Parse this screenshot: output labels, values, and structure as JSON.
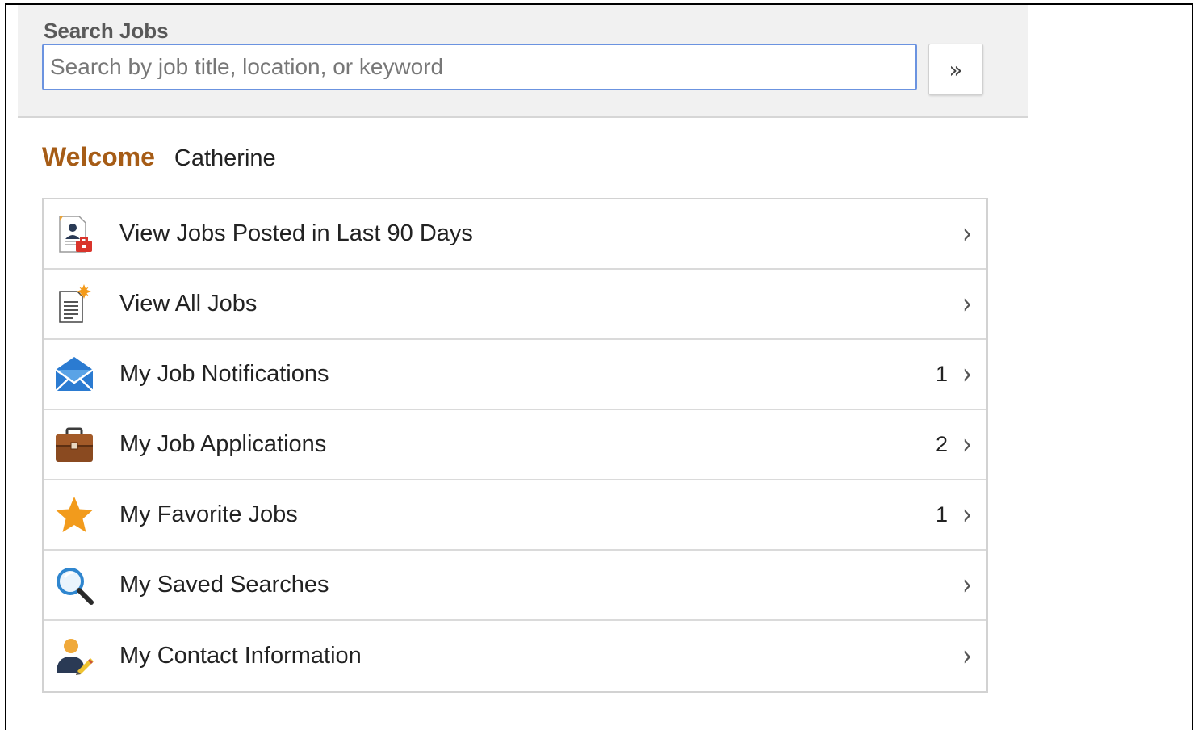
{
  "search": {
    "label": "Search Jobs",
    "placeholder": "Search by job title, location, or keyword",
    "value": "",
    "button_glyph": "»"
  },
  "welcome": {
    "label": "Welcome",
    "name": "Catherine"
  },
  "menu": {
    "chevron": "›",
    "items": [
      {
        "label": "View Jobs Posted in Last 90 Days",
        "count": "",
        "icon": "recent-jobs-icon"
      },
      {
        "label": "View All Jobs",
        "count": "",
        "icon": "all-jobs-icon"
      },
      {
        "label": "My Job Notifications",
        "count": "1",
        "icon": "envelope-icon"
      },
      {
        "label": "My Job Applications",
        "count": "2",
        "icon": "briefcase-icon"
      },
      {
        "label": "My Favorite Jobs",
        "count": "1",
        "icon": "star-icon"
      },
      {
        "label": "My Saved Searches",
        "count": "",
        "icon": "magnifier-icon"
      },
      {
        "label": "My Contact Information",
        "count": "",
        "icon": "contact-person-icon"
      }
    ]
  },
  "colors": {
    "welcome": "#a65c16",
    "search_border": "#6b93e0",
    "star": "#f29b1c",
    "envelope": "#2b7bd1",
    "briefcase": "#8a4a20"
  }
}
